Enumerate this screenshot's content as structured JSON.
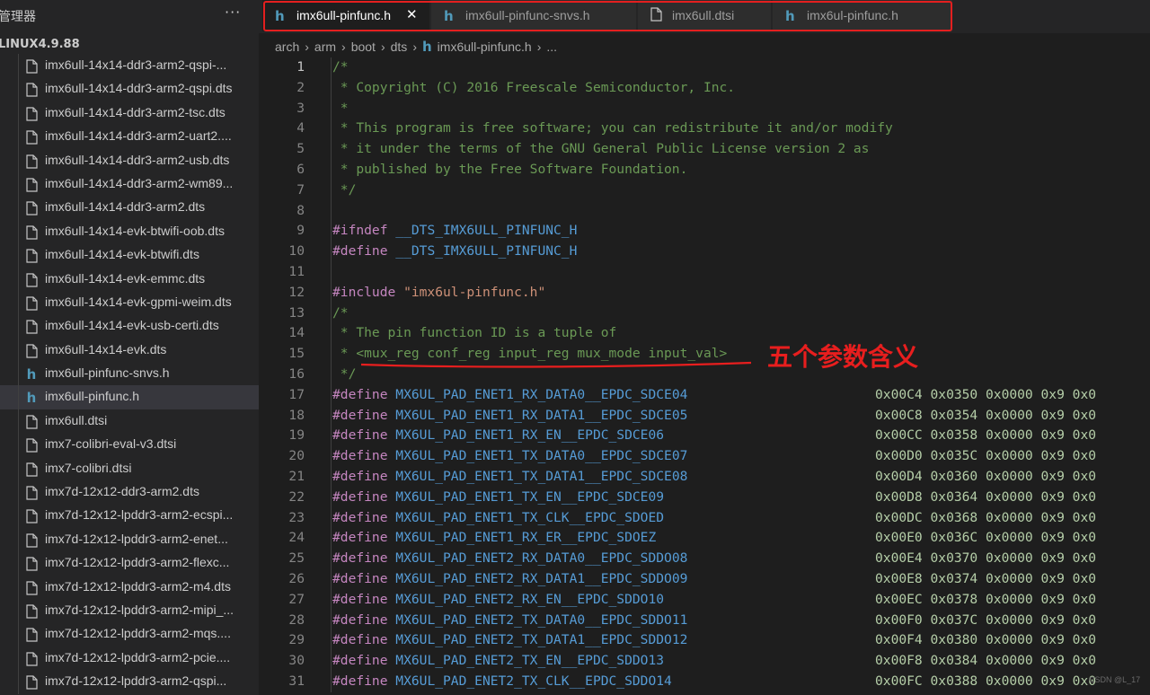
{
  "sidebar": {
    "title": "管理器",
    "more_label": "···",
    "root_folder": "LINUX4.9.88",
    "items": [
      {
        "name": "imx6ull-14x14-ddr3-arm2-qspi-...",
        "type": "file"
      },
      {
        "name": "imx6ull-14x14-ddr3-arm2-qspi.dts",
        "type": "file"
      },
      {
        "name": "imx6ull-14x14-ddr3-arm2-tsc.dts",
        "type": "file"
      },
      {
        "name": "imx6ull-14x14-ddr3-arm2-uart2....",
        "type": "file"
      },
      {
        "name": "imx6ull-14x14-ddr3-arm2-usb.dts",
        "type": "file"
      },
      {
        "name": "imx6ull-14x14-ddr3-arm2-wm89...",
        "type": "file"
      },
      {
        "name": "imx6ull-14x14-ddr3-arm2.dts",
        "type": "file"
      },
      {
        "name": "imx6ull-14x14-evk-btwifi-oob.dts",
        "type": "file"
      },
      {
        "name": "imx6ull-14x14-evk-btwifi.dts",
        "type": "file"
      },
      {
        "name": "imx6ull-14x14-evk-emmc.dts",
        "type": "file"
      },
      {
        "name": "imx6ull-14x14-evk-gpmi-weim.dts",
        "type": "file"
      },
      {
        "name": "imx6ull-14x14-evk-usb-certi.dts",
        "type": "file"
      },
      {
        "name": "imx6ull-14x14-evk.dts",
        "type": "file"
      },
      {
        "name": "imx6ull-pinfunc-snvs.h",
        "type": "header"
      },
      {
        "name": "imx6ull-pinfunc.h",
        "type": "header",
        "selected": true
      },
      {
        "name": "imx6ull.dtsi",
        "type": "file"
      },
      {
        "name": "imx7-colibri-eval-v3.dtsi",
        "type": "file"
      },
      {
        "name": "imx7-colibri.dtsi",
        "type": "file"
      },
      {
        "name": "imx7d-12x12-ddr3-arm2.dts",
        "type": "file"
      },
      {
        "name": "imx7d-12x12-lpddr3-arm2-ecspi...",
        "type": "file"
      },
      {
        "name": "imx7d-12x12-lpddr3-arm2-enet...",
        "type": "file"
      },
      {
        "name": "imx7d-12x12-lpddr3-arm2-flexc...",
        "type": "file"
      },
      {
        "name": "imx7d-12x12-lpddr3-arm2-m4.dts",
        "type": "file"
      },
      {
        "name": "imx7d-12x12-lpddr3-arm2-mipi_...",
        "type": "file"
      },
      {
        "name": "imx7d-12x12-lpddr3-arm2-mqs....",
        "type": "file"
      },
      {
        "name": "imx7d-12x12-lpddr3-arm2-pcie....",
        "type": "file"
      },
      {
        "name": "imx7d-12x12-lpddr3-arm2-qspi...",
        "type": "file"
      }
    ]
  },
  "tabs": [
    {
      "label": "imx6ull-pinfunc.h",
      "type": "header",
      "active": true,
      "close": "✕"
    },
    {
      "label": "imx6ull-pinfunc-snvs.h",
      "type": "header",
      "active": false
    },
    {
      "label": "imx6ull.dtsi",
      "type": "file",
      "active": false
    },
    {
      "label": "imx6ul-pinfunc.h",
      "type": "header",
      "active": false
    }
  ],
  "breadcrumb": {
    "parts": [
      "arch",
      "arm",
      "boot",
      "dts",
      "imx6ull-pinfunc.h",
      "..."
    ]
  },
  "editor": {
    "header_lines": [
      {
        "n": "1",
        "segs": [
          {
            "t": "/*",
            "c": "c-comment"
          }
        ]
      },
      {
        "n": "2",
        "segs": [
          {
            "t": " * Copyright (C) 2016 Freescale Semiconductor, Inc.",
            "c": "c-comment"
          }
        ]
      },
      {
        "n": "3",
        "segs": [
          {
            "t": " *",
            "c": "c-comment"
          }
        ]
      },
      {
        "n": "4",
        "segs": [
          {
            "t": " * This program is free software; you can redistribute it and/or modify",
            "c": "c-comment"
          }
        ]
      },
      {
        "n": "5",
        "segs": [
          {
            "t": " * it under the terms of the GNU General Public License version 2 as",
            "c": "c-comment"
          }
        ]
      },
      {
        "n": "6",
        "segs": [
          {
            "t": " * published by the Free Software Foundation.",
            "c": "c-comment"
          }
        ]
      },
      {
        "n": "7",
        "segs": [
          {
            "t": " */",
            "c": "c-comment"
          }
        ]
      },
      {
        "n": "8",
        "segs": []
      },
      {
        "n": "9",
        "segs": [
          {
            "t": "#ifndef ",
            "c": "c-pre"
          },
          {
            "t": "__DTS_IMX6ULL_PINFUNC_H",
            "c": "c-macro"
          }
        ]
      },
      {
        "n": "10",
        "segs": [
          {
            "t": "#define ",
            "c": "c-pre"
          },
          {
            "t": "__DTS_IMX6ULL_PINFUNC_H",
            "c": "c-macro"
          }
        ]
      },
      {
        "n": "11",
        "segs": []
      },
      {
        "n": "12",
        "segs": [
          {
            "t": "#include ",
            "c": "c-pre"
          },
          {
            "t": "\"imx6ul-pinfunc.h\"",
            "c": "c-str"
          }
        ]
      },
      {
        "n": "13",
        "segs": [
          {
            "t": "/*",
            "c": "c-comment"
          }
        ]
      },
      {
        "n": "14",
        "segs": [
          {
            "t": " * The pin function ID is a tuple of",
            "c": "c-comment"
          }
        ]
      },
      {
        "n": "15",
        "segs": [
          {
            "t": " * <mux_reg conf_reg input_reg mux_mode input_val>",
            "c": "c-comment"
          }
        ]
      },
      {
        "n": "16",
        "segs": [
          {
            "t": " */",
            "c": "c-comment"
          }
        ]
      }
    ],
    "define_keyword": "#define ",
    "defines": [
      {
        "n": "17",
        "name": "MX6UL_PAD_ENET1_RX_DATA0__EPDC_SDCE04",
        "vals": "0x00C4 0x0350 0x0000 0x9 0x0"
      },
      {
        "n": "18",
        "name": "MX6UL_PAD_ENET1_RX_DATA1__EPDC_SDCE05",
        "vals": "0x00C8 0x0354 0x0000 0x9 0x0"
      },
      {
        "n": "19",
        "name": "MX6UL_PAD_ENET1_RX_EN__EPDC_SDCE06",
        "vals": "0x00CC 0x0358 0x0000 0x9 0x0"
      },
      {
        "n": "20",
        "name": "MX6UL_PAD_ENET1_TX_DATA0__EPDC_SDCE07",
        "vals": "0x00D0 0x035C 0x0000 0x9 0x0"
      },
      {
        "n": "21",
        "name": "MX6UL_PAD_ENET1_TX_DATA1__EPDC_SDCE08",
        "vals": "0x00D4 0x0360 0x0000 0x9 0x0"
      },
      {
        "n": "22",
        "name": "MX6UL_PAD_ENET1_TX_EN__EPDC_SDCE09",
        "vals": "0x00D8 0x0364 0x0000 0x9 0x0"
      },
      {
        "n": "23",
        "name": "MX6UL_PAD_ENET1_TX_CLK__EPDC_SDOED",
        "vals": "0x00DC 0x0368 0x0000 0x9 0x0"
      },
      {
        "n": "24",
        "name": "MX6UL_PAD_ENET1_RX_ER__EPDC_SDOEZ",
        "vals": "0x00E0 0x036C 0x0000 0x9 0x0"
      },
      {
        "n": "25",
        "name": "MX6UL_PAD_ENET2_RX_DATA0__EPDC_SDDO08",
        "vals": "0x00E4 0x0370 0x0000 0x9 0x0"
      },
      {
        "n": "26",
        "name": "MX6UL_PAD_ENET2_RX_DATA1__EPDC_SDDO09",
        "vals": "0x00E8 0x0374 0x0000 0x9 0x0"
      },
      {
        "n": "27",
        "name": "MX6UL_PAD_ENET2_RX_EN__EPDC_SDDO10",
        "vals": "0x00EC 0x0378 0x0000 0x9 0x0"
      },
      {
        "n": "28",
        "name": "MX6UL_PAD_ENET2_TX_DATA0__EPDC_SDDO11",
        "vals": "0x00F0 0x037C 0x0000 0x9 0x0"
      },
      {
        "n": "29",
        "name": "MX6UL_PAD_ENET2_TX_DATA1__EPDC_SDDO12",
        "vals": "0x00F4 0x0380 0x0000 0x9 0x0"
      },
      {
        "n": "30",
        "name": "MX6UL_PAD_ENET2_TX_EN__EPDC_SDDO13",
        "vals": "0x00F8 0x0384 0x0000 0x9 0x0"
      },
      {
        "n": "31",
        "name": "MX6UL_PAD_ENET2_TX_CLK__EPDC_SDDO14",
        "vals": "0x00FC 0x0388 0x0000 0x9 0x0"
      }
    ]
  },
  "annotation": {
    "text": "五个参数含义",
    "color": "#e81e1e"
  },
  "watermark": "CSDN @L_17",
  "colors": {
    "editor_bg": "#1e1e1e",
    "sidebar_bg": "#252526",
    "comment": "#6a9955",
    "preprocessor": "#c586c0",
    "macro": "#569cd6",
    "number": "#b5cea8",
    "header_icon": "#519aba",
    "highlight_box": "#e41f1f"
  }
}
